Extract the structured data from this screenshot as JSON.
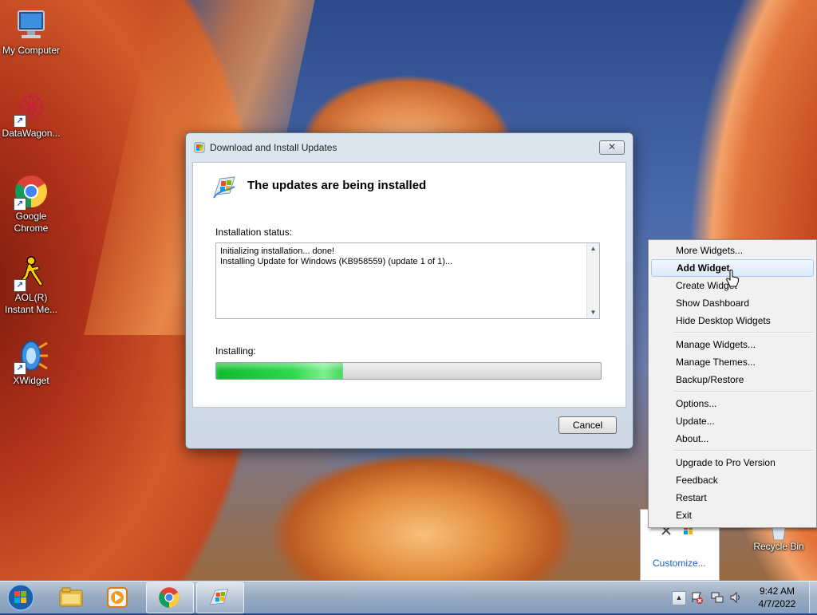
{
  "desktop": {
    "icons": [
      {
        "label": "My Computer",
        "icon": "computer-icon"
      },
      {
        "label": "DataWagon...",
        "icon": "datawagon-icon"
      },
      {
        "label": "Google Chrome",
        "icon": "chrome-icon"
      },
      {
        "label": "AOL(R) Instant Me...",
        "icon": "aol-icon"
      },
      {
        "label": "XWidget",
        "icon": "xwidget-icon"
      }
    ],
    "recycle_bin": "Recycle Bin"
  },
  "dialog": {
    "title": "Download and Install Updates",
    "close_glyph": "✕",
    "heading": "The updates are being installed",
    "status_label": "Installation status:",
    "status_lines": [
      "Initializing installation... done!",
      "Installing Update for Windows (KB958559) (update 1 of 1)..."
    ],
    "progress_label": "Installing:",
    "progress_fraction": 0.33,
    "cancel_label": "Cancel"
  },
  "context_menu": {
    "items": [
      "More Widgets...",
      "Add Widget",
      "Create Widget",
      "Show Dashboard",
      "Hide Desktop Widgets",
      "Manage Widgets...",
      "Manage Themes...",
      "Backup/Restore",
      "Options...",
      "Update...",
      "About...",
      "Upgrade to Pro Version",
      "Feedback",
      "Restart",
      "Exit"
    ],
    "highlighted": "Add Widget"
  },
  "tray_flyout": {
    "customize_label": "Customize..."
  },
  "taskbar": {
    "time": "9:42 AM",
    "date": "4/7/2022",
    "pinned": [
      "start-button",
      "explorer-icon",
      "media-player-icon",
      "chrome-icon",
      "windows-update-icon"
    ]
  },
  "colors": {
    "menu_highlight": "#dbe9fa",
    "progress_green": "#2bd94a",
    "link_blue": "#1b62b7"
  }
}
